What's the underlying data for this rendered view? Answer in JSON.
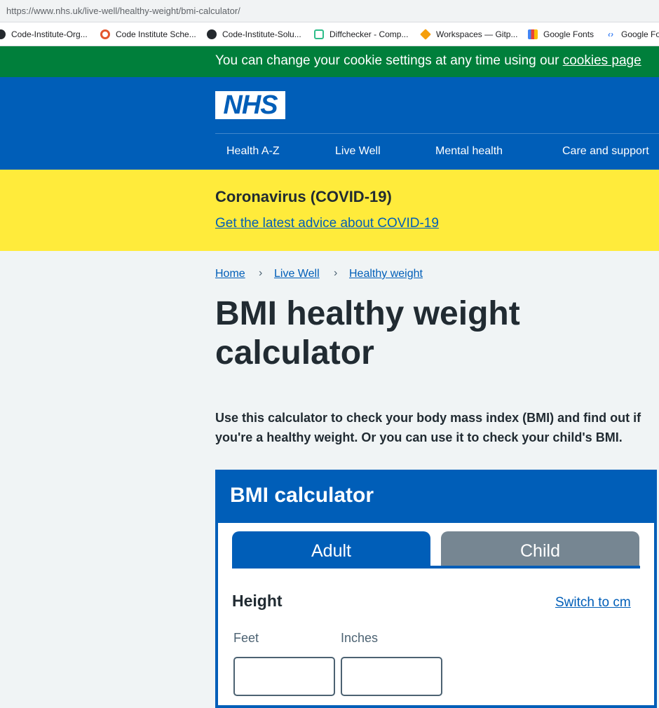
{
  "browser": {
    "url": "https://www.nhs.uk/live-well/healthy-weight/bmi-calculator/",
    "bookmarks": [
      {
        "label": "Code-Institute-Org...",
        "icon": "github-icon"
      },
      {
        "label": "Code Institute Sche...",
        "icon": "ring-icon"
      },
      {
        "label": "Code-Institute-Solu...",
        "icon": "github-icon"
      },
      {
        "label": "Diffchecker - Comp...",
        "icon": "diffchecker-icon"
      },
      {
        "label": "Workspaces — Gitp...",
        "icon": "gitpod-icon"
      },
      {
        "label": "Google Fonts",
        "icon": "google-fonts-icon"
      },
      {
        "label": "Google Fo",
        "icon": "devtools-icon"
      }
    ]
  },
  "cookie_banner": {
    "text": "You can change your cookie settings at any time using our ",
    "link": "cookies page"
  },
  "header": {
    "logo": "NHS",
    "nav": [
      "Health A-Z",
      "Live Well",
      "Mental health",
      "Care and support"
    ]
  },
  "covid": {
    "title": "Coronavirus (COVID-19)",
    "link": "Get the latest advice about COVID-19"
  },
  "breadcrumb": [
    "Home",
    "Live Well",
    "Healthy weight"
  ],
  "page": {
    "title": "BMI healthy weight calculator",
    "intro": "Use this calculator to check your body mass index (BMI) and find out if you're a healthy weight. Or you can use it to check your child's BMI."
  },
  "calculator": {
    "title": "BMI calculator",
    "tabs": [
      "Adult",
      "Child"
    ],
    "active_tab": "Adult",
    "height_label": "Height",
    "switch_link": "Switch to cm",
    "feet_label": "Feet",
    "inches_label": "Inches",
    "feet_value": "",
    "inches_value": ""
  },
  "colors": {
    "nhs_blue": "#005eb8",
    "cookie_green": "#007f3b",
    "covid_yellow": "#ffeb3b",
    "inactive_tab": "#768692"
  }
}
